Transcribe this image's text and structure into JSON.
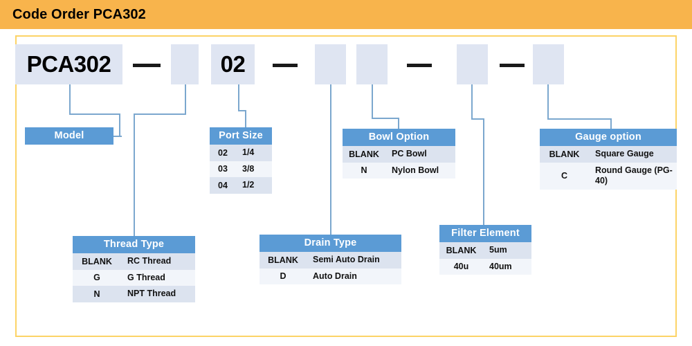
{
  "header": {
    "title": "Code Order PCA302"
  },
  "code_string": {
    "segments": [
      {
        "name": "model",
        "value": "PCA302",
        "filled": true
      },
      {
        "name": "thread-type",
        "value": "",
        "filled": false
      },
      {
        "name": "port-size",
        "value": "02",
        "filled": true
      },
      {
        "name": "drain-type",
        "value": "",
        "filled": false
      },
      {
        "name": "bowl-option",
        "value": "",
        "filled": false
      },
      {
        "name": "filter-element",
        "value": "",
        "filled": false
      },
      {
        "name": "gauge-option",
        "value": "",
        "filled": false
      }
    ],
    "separator": "—"
  },
  "tables": [
    {
      "id": "model",
      "title": "Model",
      "rows": []
    },
    {
      "id": "port-size",
      "title": "Port Size",
      "rows": [
        {
          "code": "02",
          "desc": "1/4"
        },
        {
          "code": "03",
          "desc": "3/8"
        },
        {
          "code": "04",
          "desc": "1/2"
        }
      ]
    },
    {
      "id": "bowl-option",
      "title": "Bowl Option",
      "rows": [
        {
          "code": "BLANK",
          "desc": "PC Bowl"
        },
        {
          "code": "N",
          "desc": "Nylon Bowl"
        }
      ]
    },
    {
      "id": "gauge-option",
      "title": "Gauge option",
      "rows": [
        {
          "code": "BLANK",
          "desc": "Square Gauge"
        },
        {
          "code": "C",
          "desc": "Round Gauge (PG-40)"
        }
      ]
    },
    {
      "id": "thread-type",
      "title": "Thread Type",
      "rows": [
        {
          "code": "BLANK",
          "desc": "RC Thread"
        },
        {
          "code": "G",
          "desc": "G Thread"
        },
        {
          "code": "N",
          "desc": "NPT Thread"
        }
      ]
    },
    {
      "id": "drain-type",
      "title": "Drain Type",
      "rows": [
        {
          "code": "BLANK",
          "desc": "Semi Auto Drain"
        },
        {
          "code": "D",
          "desc": "Auto Drain"
        }
      ]
    },
    {
      "id": "filter-element",
      "title": "Filter Element",
      "rows": [
        {
          "code": "BLANK",
          "desc": "5um"
        },
        {
          "code": "40u",
          "desc": "40um"
        }
      ]
    }
  ],
  "colors": {
    "header_bar": "#F8B44C",
    "frame_border": "#FCD366",
    "table_header": "#5B9BD5",
    "row_odd": "#DCE3EF",
    "row_even": "#F2F5FA",
    "code_box": "#DFE5F2",
    "connector": "#7BA7CE"
  }
}
